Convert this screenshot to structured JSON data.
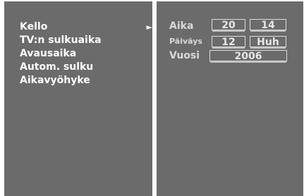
{
  "menu": {
    "items": [
      {
        "label": "Kello",
        "selected": true,
        "arrow": "►"
      },
      {
        "label": "TV:n sulkuaika"
      },
      {
        "label": "Avausaika"
      },
      {
        "label": "Autom. sulku"
      },
      {
        "label": "Aikavyöhyke"
      }
    ]
  },
  "clock": {
    "time_label": "Aika",
    "hour": "20",
    "minute": "14",
    "date_label": "Päiväys",
    "day": "12",
    "month": "Huh",
    "year_label": "Vuosi",
    "year": "2006"
  },
  "colors": {
    "panel": "#6b6b6b",
    "frame": "#ffffff",
    "text": "#ffffff",
    "muted_text": "#d9d9d9"
  }
}
